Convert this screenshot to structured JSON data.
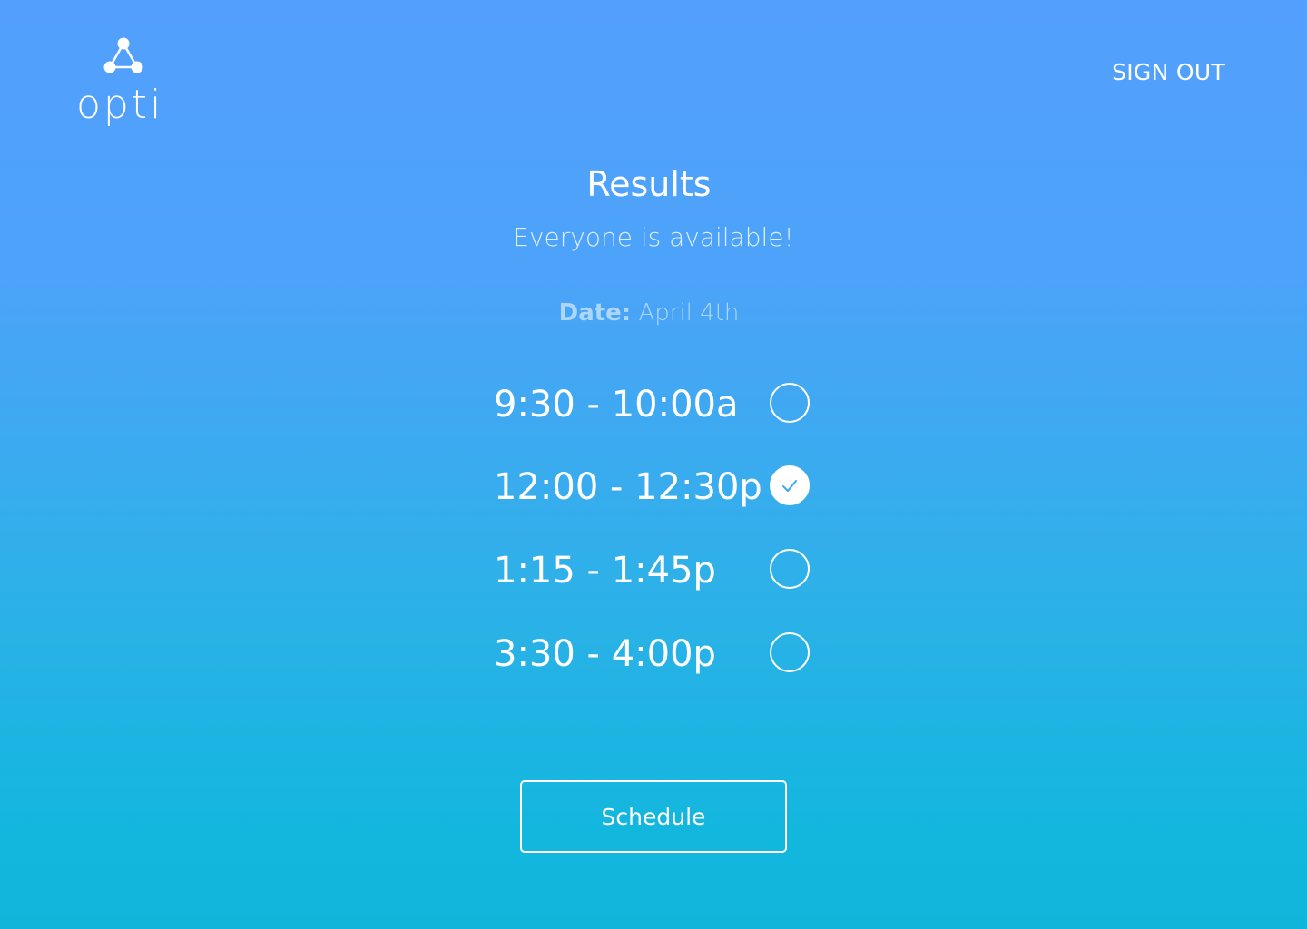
{
  "brand": {
    "logo_text": "opti",
    "logo_icon": "connected-nodes-icon"
  },
  "header": {
    "sign_out_label": "SIGN OUT"
  },
  "results": {
    "title": "Results",
    "subtitle": "Everyone is available!",
    "date_label": "Date:",
    "date_value": "April 4th"
  },
  "slots": [
    {
      "time": "9:30 - 10:00a",
      "selected": false
    },
    {
      "time": "12:00 - 12:30p",
      "selected": true
    },
    {
      "time": "1:15 - 1:45p",
      "selected": false
    },
    {
      "time": "3:30 - 4:00p",
      "selected": false
    }
  ],
  "actions": {
    "schedule_label": "Schedule"
  },
  "colors": {
    "gradient_top": "#529ffd",
    "gradient_bottom": "#0fb6da",
    "foreground": "#ffffff",
    "check_color": "#3aa7ee"
  }
}
